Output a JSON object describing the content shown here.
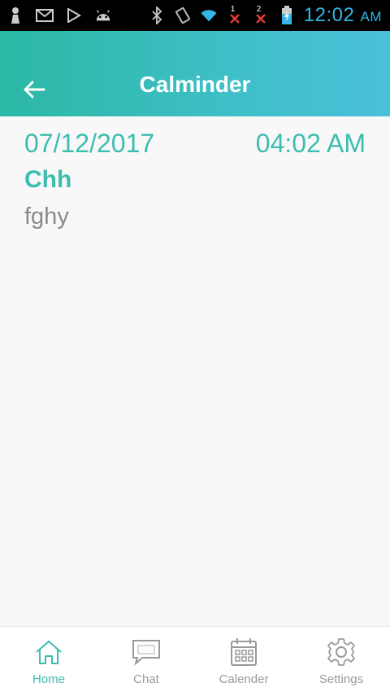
{
  "status_bar": {
    "time": "12:02",
    "ampm": "AM",
    "sim1": "1",
    "sim2": "2",
    "icons": [
      "person-icon",
      "mail-icon",
      "play-store-icon",
      "android-icon",
      "bluetooth-icon",
      "vibrate-icon",
      "wifi-icon",
      "no-signal-icon",
      "no-signal-icon",
      "battery-charging-icon"
    ],
    "time_color": "#33b5e5"
  },
  "app_bar": {
    "title": "Calminder",
    "back_icon": "arrow-left-icon",
    "gradient": [
      "#2bb8a4",
      "#4abfd9"
    ]
  },
  "entry": {
    "date": "07/12/2017",
    "time": "04:02 AM",
    "title": "Chh",
    "body": "fghy"
  },
  "bottom_nav": {
    "items": [
      {
        "label": "Home",
        "icon": "home-icon",
        "active": true
      },
      {
        "label": "Chat",
        "icon": "chat-icon",
        "active": false
      },
      {
        "label": "Calender",
        "icon": "calendar-icon",
        "active": false
      },
      {
        "label": "Settings",
        "icon": "gear-icon",
        "active": false
      }
    ]
  },
  "colors": {
    "accent": "#3dbdb0",
    "muted": "#9a9a9a"
  }
}
